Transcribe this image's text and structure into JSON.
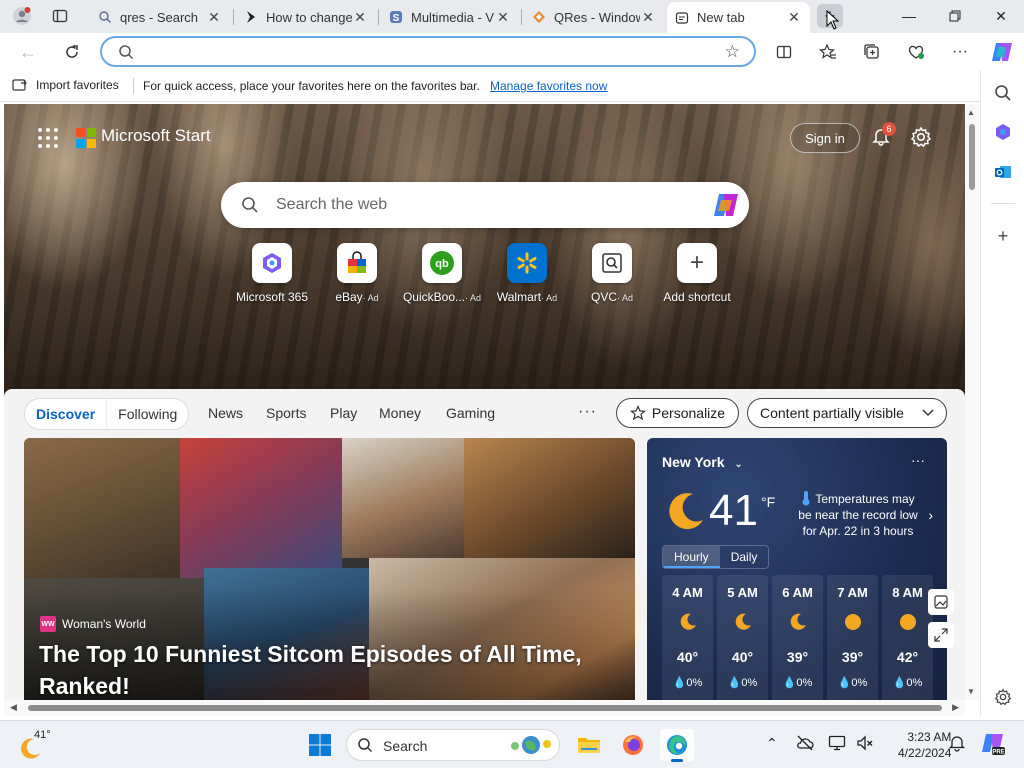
{
  "tabs": [
    {
      "title": "qres - Search",
      "icon": "search-icon"
    },
    {
      "title": "How to change",
      "icon": "pin-logo-icon"
    },
    {
      "title": "Multimedia - V",
      "icon": "s-logo-icon"
    },
    {
      "title": "QRes - Window",
      "icon": "diamond-logo-icon"
    },
    {
      "title": "New tab",
      "icon": "newtab-icon",
      "active": true
    }
  ],
  "address_bar": {
    "value": "",
    "placeholder": ""
  },
  "favorites_bar": {
    "import_label": "Import favorites",
    "message": "For quick access, place your favorites here on the favorites bar.",
    "manage_link": "Manage favorites now"
  },
  "ms_start": {
    "brand": "Microsoft Start",
    "sign_in": "Sign in",
    "notification_count": "6",
    "search_placeholder": "Search the web"
  },
  "shortcuts": [
    {
      "label": "Microsoft 365",
      "ad": ""
    },
    {
      "label": "eBay",
      "ad": "· Ad"
    },
    {
      "label": "QuickBoo...",
      "ad": "· Ad"
    },
    {
      "label": "Walmart",
      "ad": "· Ad"
    },
    {
      "label": "QVC",
      "ad": "· Ad"
    },
    {
      "label": "Add shortcut",
      "ad": ""
    }
  ],
  "feed_nav": {
    "discover": "Discover",
    "following": "Following",
    "links": [
      "News",
      "Sports",
      "Play",
      "Money",
      "Gaming"
    ],
    "more": "···",
    "personalize": "Personalize",
    "content_visibility": "Content partially visible"
  },
  "hero_article": {
    "source": "Woman's World",
    "source_logo": "WW",
    "title": "The Top 10 Funniest Sitcom Episodes of All Time, Ranked!"
  },
  "weather": {
    "city": "New York",
    "temp": "41",
    "unit": "°F",
    "alert": "Temperatures may be near the record low for Apr. 22 in 3 hours",
    "tab_hourly": "Hourly",
    "tab_daily": "Daily",
    "hours": [
      {
        "time": "4 AM",
        "icon": "moon",
        "temp": "40°",
        "precip": "0%"
      },
      {
        "time": "5 AM",
        "icon": "moon",
        "temp": "40°",
        "precip": "0%"
      },
      {
        "time": "6 AM",
        "icon": "moon",
        "temp": "39°",
        "precip": "0%"
      },
      {
        "time": "7 AM",
        "icon": "sun",
        "temp": "39°",
        "precip": "0%"
      },
      {
        "time": "8 AM",
        "icon": "sun",
        "temp": "42°",
        "precip": "0%"
      }
    ]
  },
  "taskbar": {
    "weather_temp": "41°",
    "search_label": "Search",
    "time": "3:23 AM",
    "date": "4/22/2024"
  },
  "colors": {
    "accent": "#0b62c9",
    "weather_bg": "#1b2b4e",
    "badge": "#e0533d"
  }
}
